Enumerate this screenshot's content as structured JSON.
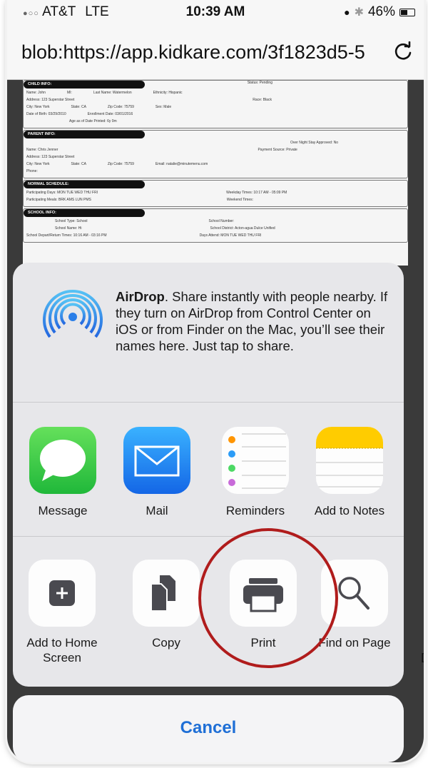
{
  "status_bar": {
    "carrier": "AT&T",
    "network": "LTE",
    "time": "10:39 AM",
    "battery": "46%",
    "battery_level": 0.46
  },
  "browser": {
    "url": "blob:https://app.kidkare.com/3f1823d5-5"
  },
  "document": {
    "status": "Status: Pending",
    "child_info": {
      "heading": "CHILD INFO:",
      "rows": [
        [
          "Name: John",
          "MI:",
          "Last Name: Watermelon",
          "Ethnicity: Hispanic"
        ],
        [
          "Address: 123 Superstar Street",
          "",
          "",
          "Race: Black"
        ],
        [
          "City: New York",
          "State: CA",
          "Zip Code: 75759",
          "Sex: Male"
        ],
        [
          "Date of Birth: 03/29/2010",
          "Enrollment Date: 03/01/2016",
          "",
          ""
        ],
        [
          "Age as of Date Printed: 6y 0m",
          "",
          "",
          ""
        ]
      ]
    },
    "parent_info": {
      "heading": "PARENT INFO:",
      "rows": [
        [
          "",
          "",
          "",
          "Over Night Stay Approved: No"
        ],
        [
          "Name: Chris Jenner",
          "",
          "",
          "Payment Source: Private"
        ],
        [
          "Address: 123 Superstar Street",
          "",
          "",
          ""
        ],
        [
          "City: New York",
          "State: CA",
          "Zip Code: 75759",
          "Email: natalie@minutemenu.com"
        ],
        [
          "Phone:",
          "",
          "",
          ""
        ]
      ]
    },
    "normal_schedule": {
      "heading": "NORMAL SCHEDULE:",
      "rows": [
        [
          "Participating Days: MON TUE WED THU FRI",
          "Weekday Times: 10:17 AM - 05:09 PM"
        ],
        [
          "Participating Meals: BRK AMS LUN PMS",
          "Weekend Times:"
        ]
      ]
    },
    "school_info": {
      "heading": "SCHOOL INFO:",
      "rows": [
        [
          "School Type: School",
          "School Number:"
        ],
        [
          "School Name: Hi",
          "School District: Acton-agua Dulce Unified"
        ],
        [
          "School Depart/Return Times: 10:16 AM - 03:16 PM",
          "Days Attend: MON TUE WED THU FRI"
        ]
      ]
    }
  },
  "share_sheet": {
    "airdrop": {
      "title": "AirDrop",
      "description": ". Share instantly with people nearby. If they turn on AirDrop from Control Center on iOS or from Finder on the Mac, you’ll see their names here. Just tap to share."
    },
    "apps": [
      {
        "label": "Message",
        "icon": "messages-icon",
        "color": "#34c759"
      },
      {
        "label": "Mail",
        "icon": "mail-icon",
        "color": "#1e88f5"
      },
      {
        "label": "Reminders",
        "icon": "reminders-icon",
        "color": "#ffffff"
      },
      {
        "label": "Add to Notes",
        "icon": "notes-icon",
        "color": "#ffcc00"
      }
    ],
    "actions": [
      {
        "label": "Add to Home Screen",
        "icon": "add-home-screen-icon"
      },
      {
        "label": "Copy",
        "icon": "copy-icon"
      },
      {
        "label": "Print",
        "icon": "printer-icon"
      },
      {
        "label": "Find on Page",
        "icon": "search-icon"
      }
    ],
    "cancel_label": "Cancel"
  },
  "colors": {
    "highlight": "#b01c1c",
    "link_blue": "#1f6fd6"
  }
}
